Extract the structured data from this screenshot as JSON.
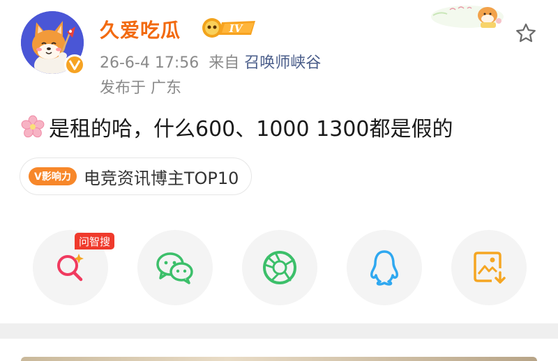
{
  "post": {
    "author": {
      "name": "久爱吃瓜",
      "level": "IV"
    },
    "timestamp": "26-6-4 17:56",
    "source_prefix": "来自",
    "source": "召唤师峡谷",
    "location": "发布于 广东",
    "text": "是租的哈，什么600、1000  1300都是假的",
    "influence": {
      "badge": "V影响力",
      "label": "电竞资讯博主TOP10"
    }
  },
  "share": {
    "ask_badge": "问智搜",
    "items": [
      {
        "name": "smart-search",
        "icon": "magnifier-sparkle-icon",
        "color": "#f03a5f"
      },
      {
        "name": "wechat",
        "icon": "wechat-icon",
        "color": "#3cbf6a"
      },
      {
        "name": "moments",
        "icon": "aperture-icon",
        "color": "#3cbf6a"
      },
      {
        "name": "qq",
        "icon": "penguin-icon",
        "color": "#2fa8f0"
      },
      {
        "name": "save-image",
        "icon": "image-download-icon",
        "color": "#f5a623"
      }
    ]
  },
  "colors": {
    "username": "#f26a10",
    "source_link": "#4a5d8a",
    "meta": "#8a8a8a",
    "influence_pill": "#f7872a",
    "ask_badge": "#ef3a2c"
  }
}
